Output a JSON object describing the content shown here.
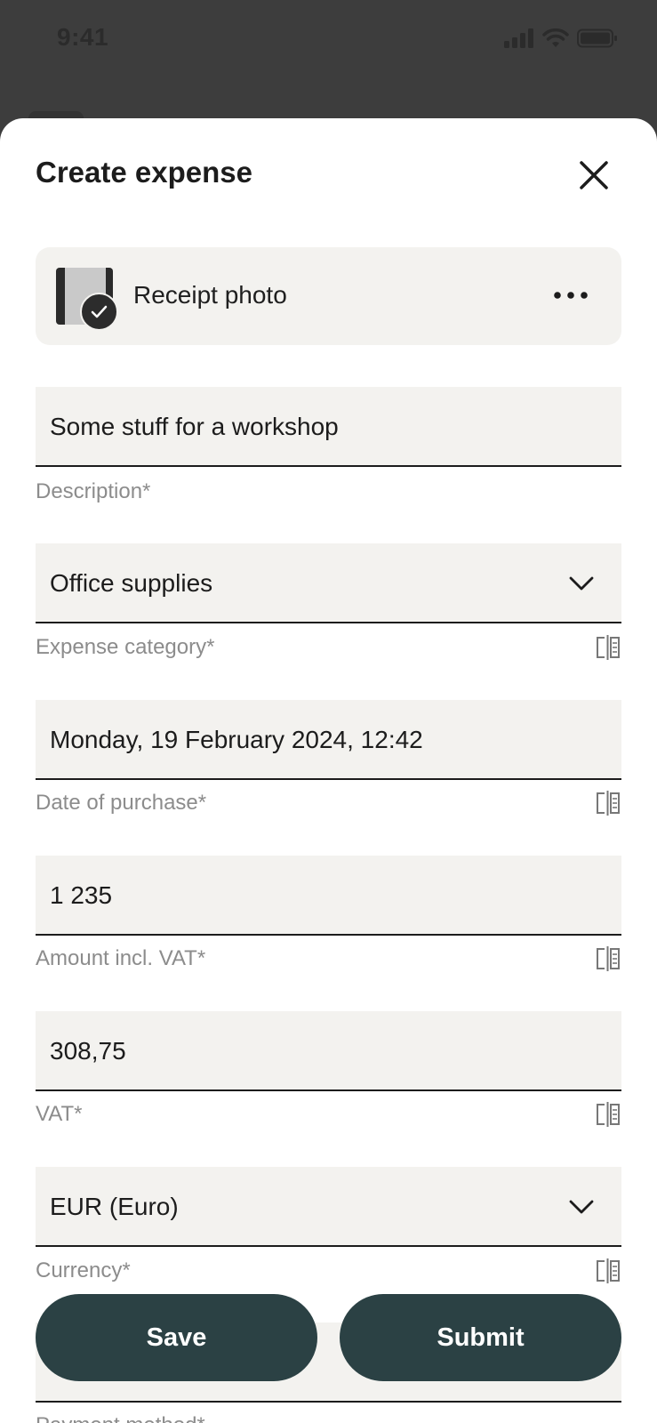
{
  "status": {
    "time": "9:41"
  },
  "sheet": {
    "title": "Create expense",
    "close_icon": "close-icon"
  },
  "receipt": {
    "label": "Receipt photo",
    "status_icon": "check-icon",
    "menu_icon": "more-horizontal-icon"
  },
  "fields": {
    "description": {
      "value": "Some stuff for a workshop",
      "label": "Description*"
    },
    "category": {
      "value": "Office supplies",
      "label": "Expense category*"
    },
    "date": {
      "value": "Monday, 19 February 2024, 12:42",
      "label": "Date of purchase*"
    },
    "amount": {
      "value": "1 235",
      "label": "Amount incl. VAT*"
    },
    "vat": {
      "value": "308,75",
      "label": "VAT*"
    },
    "currency": {
      "value": "EUR (Euro)",
      "label": "Currency*"
    },
    "payment": {
      "label": "Payment method*"
    }
  },
  "actions": {
    "save": "Save",
    "submit": "Submit"
  },
  "colors": {
    "primary_button": "#2b4144",
    "field_background": "#f3f2ef",
    "label_gray": "#8c8c8c"
  }
}
